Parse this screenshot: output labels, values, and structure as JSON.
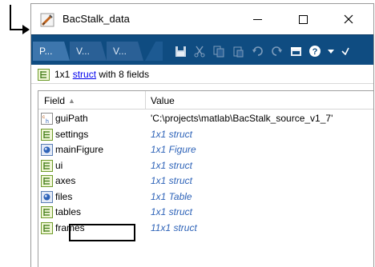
{
  "window": {
    "title": "BacStalk_data",
    "controls": {
      "minimize": "minimize",
      "maximize": "maximize",
      "close": "close"
    }
  },
  "toolbar": {
    "tabs": [
      "P...",
      "V...",
      "V..."
    ],
    "tools": [
      "save-icon",
      "cut-icon",
      "copy-icon",
      "paste-icon",
      "undo-icon",
      "redo-icon",
      "window-layout-icon",
      "help-icon",
      "dropdown-icon",
      "undock-icon"
    ],
    "accent": "#0f4c81"
  },
  "info": {
    "size": "1x1",
    "link": "struct",
    "suffix": "with 8 fields"
  },
  "table": {
    "headers": {
      "field": "Field",
      "value": "Value"
    },
    "rows": [
      {
        "icon": "char-icon",
        "name": "guiPath",
        "value": "'C:\\projects\\matlab\\BacStalk_source_v1_7'",
        "style": "plain"
      },
      {
        "icon": "struct-icon",
        "name": "settings",
        "value": "1x1 struct",
        "style": "italic"
      },
      {
        "icon": "object-icon",
        "name": "mainFigure",
        "value": "1x1 Figure",
        "style": "italic"
      },
      {
        "icon": "struct-icon",
        "name": "ui",
        "value": "1x1 struct",
        "style": "italic"
      },
      {
        "icon": "struct-icon",
        "name": "axes",
        "value": "1x1 struct",
        "style": "italic"
      },
      {
        "icon": "object-icon",
        "name": "files",
        "value": "1x1 Table",
        "style": "italic"
      },
      {
        "icon": "struct-icon",
        "name": "tables",
        "value": "1x1 struct",
        "style": "italic"
      },
      {
        "icon": "struct-icon",
        "name": "frames",
        "value": "11x1 struct",
        "style": "italic"
      }
    ]
  },
  "colors": {
    "value_italic": "#2e63b8",
    "link": "#0000ee"
  }
}
